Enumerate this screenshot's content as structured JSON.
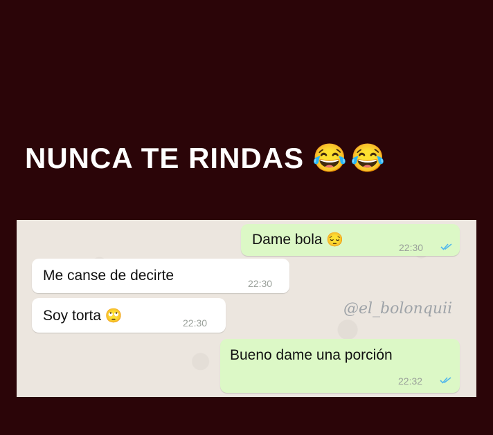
{
  "headline": {
    "text": "NUNCA TE RINDAS",
    "emojis": [
      "😂",
      "😂"
    ]
  },
  "chat": {
    "watermark": "@el_bolonquii",
    "messages": [
      {
        "direction": "outgoing",
        "text": "Dame bola",
        "emoji": "😔",
        "time": "22:30",
        "status_icon": "double-check-icon"
      },
      {
        "direction": "incoming",
        "text": "Me canse de decirte",
        "emoji": "",
        "time": "22:30"
      },
      {
        "direction": "incoming",
        "text": "Soy torta",
        "emoji": "🙄",
        "time": "22:30"
      },
      {
        "direction": "outgoing",
        "text": "Bueno dame una porción",
        "emoji": "",
        "time": "22:32",
        "status_icon": "double-check-icon"
      }
    ]
  },
  "colors": {
    "background": "#2b0508",
    "chat_background": "#ece6df",
    "outgoing_bubble": "#dcf8c6",
    "incoming_bubble": "#ffffff",
    "read_check": "#4fb6ec"
  }
}
